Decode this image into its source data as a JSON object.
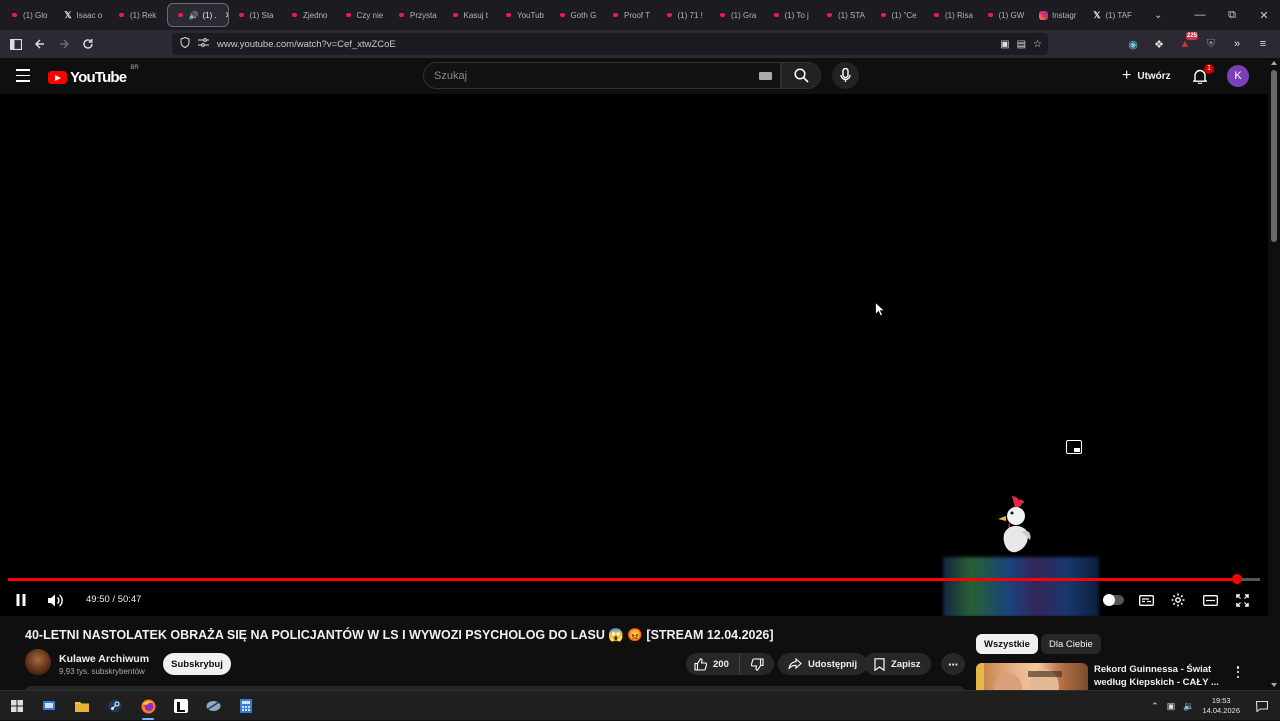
{
  "browser": {
    "tabs": [
      {
        "label": "(1) Glo",
        "icon": "youtube-icon"
      },
      {
        "label": "Isaac o",
        "icon": "x-icon"
      },
      {
        "label": "(1) Rek",
        "icon": "youtube-icon"
      },
      {
        "label": "(1) .",
        "icon": "youtube-icon",
        "active": true
      },
      {
        "label": "(1) Sta",
        "icon": "youtube-icon"
      },
      {
        "label": "Zjedno",
        "icon": "youtube-icon"
      },
      {
        "label": "Czy nie",
        "icon": "youtube-icon"
      },
      {
        "label": "Przysta",
        "icon": "youtube-icon"
      },
      {
        "label": "Kasuj t",
        "icon": "youtube-icon"
      },
      {
        "label": "YouTub",
        "icon": "youtube-icon"
      },
      {
        "label": "Goth G",
        "icon": "youtube-icon"
      },
      {
        "label": "Proof T",
        "icon": "youtube-icon"
      },
      {
        "label": "(1) 71 !",
        "icon": "youtube-icon"
      },
      {
        "label": "(1) Gra",
        "icon": "youtube-icon"
      },
      {
        "label": "(1) To j",
        "icon": "youtube-icon"
      },
      {
        "label": "(1) STA",
        "icon": "youtube-icon"
      },
      {
        "label": "(1) \"Ce",
        "icon": "youtube-icon"
      },
      {
        "label": "(1) Risa",
        "icon": "youtube-icon"
      },
      {
        "label": "(1) GW",
        "icon": "youtube-icon"
      },
      {
        "label": "Instagr",
        "icon": "instagram-icon"
      },
      {
        "label": "(1) TAF",
        "icon": "x-icon"
      }
    ],
    "url": "www.youtube.com/watch?v=Cef_xtwZCoE",
    "extension_badge": "225"
  },
  "youtube": {
    "logo_text": "YouTube",
    "country_code": "BR",
    "search_placeholder": "Szukaj",
    "create_label": "Utwórz",
    "notification_count": "1",
    "avatar_letter": "K",
    "accent_color": "#ff0000"
  },
  "player": {
    "current_time": "49:50",
    "duration": "50:47",
    "time_display": "49:50 / 50:47",
    "progress": 0.9813,
    "playing": true
  },
  "video": {
    "title": "40-LETNI NASTOLATEK OBRAŻA SIĘ NA POLICJANTÓW W LS I WYWOZI PSYCHOLOG DO LASU 😱 😡 [STREAM 12.04.2026]",
    "channel_name": "Kulawe Archiwum",
    "subscribers": "9,93 tys. subskrybentów",
    "subscribe_label": "Subskrybuj",
    "likes": "200",
    "share_label": "Udostępnij",
    "save_label": "Zapisz"
  },
  "sidebar": {
    "chips": [
      "Wszystkie",
      "Dla Ciebie"
    ],
    "recommendation_title": "Rekord Guinnessa - Świat według Kiepskich - CAŁY ..."
  },
  "taskbar": {
    "time": "19:53",
    "date": "14.04.2026"
  }
}
